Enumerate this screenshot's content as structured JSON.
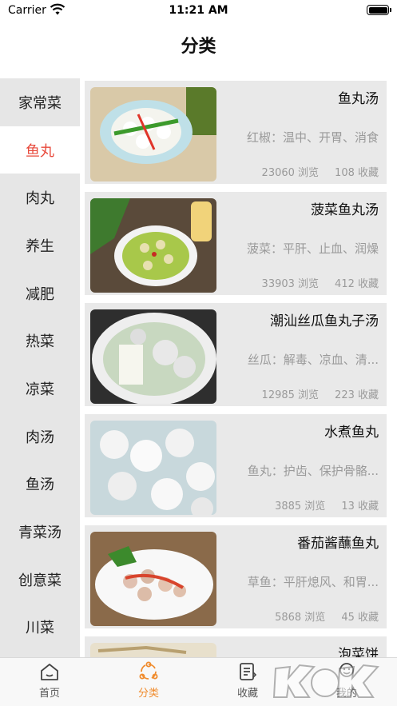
{
  "status_bar": {
    "carrier": "Carrier",
    "time": "11:21 AM"
  },
  "nav": {
    "title": "分类"
  },
  "sidebar": {
    "items": [
      {
        "label": "家常菜",
        "active": false
      },
      {
        "label": "鱼丸",
        "active": true
      },
      {
        "label": "肉丸",
        "active": false
      },
      {
        "label": "养生",
        "active": false
      },
      {
        "label": "减肥",
        "active": false
      },
      {
        "label": "热菜",
        "active": false
      },
      {
        "label": "凉菜",
        "active": false
      },
      {
        "label": "肉汤",
        "active": false
      },
      {
        "label": "鱼汤",
        "active": false
      },
      {
        "label": "青菜汤",
        "active": false
      },
      {
        "label": "创意菜",
        "active": false
      },
      {
        "label": "川菜",
        "active": false
      }
    ]
  },
  "recipes": [
    {
      "title": "鱼丸汤",
      "desc": "红椒：温中、开胃、消食",
      "views": "23060 浏览",
      "favorites": "108 收藏"
    },
    {
      "title": "菠菜鱼丸汤",
      "desc": "菠菜：平肝、止血、润燥",
      "views": "33903 浏览",
      "favorites": "412 收藏"
    },
    {
      "title": "潮汕丝瓜鱼丸子汤",
      "desc": "丝瓜：解毒、凉血、清...",
      "views": "12985 浏览",
      "favorites": "223 收藏"
    },
    {
      "title": "水煮鱼丸",
      "desc": "鱼丸：护齿、保护骨骼...",
      "views": "3885 浏览",
      "favorites": "13 收藏"
    },
    {
      "title": "番茄酱蘸鱼丸",
      "desc": "草鱼：平肝熄风、和胃...",
      "views": "5868 浏览",
      "favorites": "45 收藏"
    },
    {
      "title": "泡菜饼",
      "desc": "",
      "views": "",
      "favorites": ""
    }
  ],
  "tabbar": {
    "tabs": [
      {
        "label": "首页",
        "icon": "home-icon",
        "active": false
      },
      {
        "label": "分类",
        "icon": "category-icon",
        "active": true
      },
      {
        "label": "收藏",
        "icon": "favorites-icon",
        "active": false
      },
      {
        "label": "我的",
        "icon": "profile-icon",
        "active": false
      }
    ]
  },
  "watermark": {
    "text": "K73"
  },
  "colors": {
    "accent_red": "#e84a3c",
    "tab_active": "#f08c2e",
    "sidebar_bg": "#e6e6e6",
    "card_bg": "#e9e9e9"
  }
}
